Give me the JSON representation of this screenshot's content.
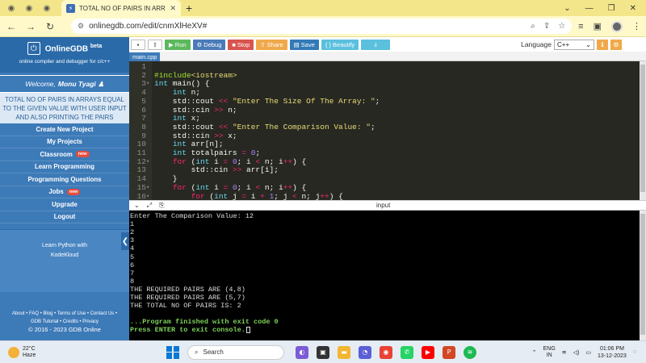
{
  "browser": {
    "tab_title": "TOTAL NO OF PAIRS IN ARRAYS",
    "tab_favicon": "⚡",
    "url": "onlinegdb.com/edit/cnmXlHeXV#"
  },
  "sidebar": {
    "logo_name": "OnlineGDB",
    "logo_beta": "beta",
    "logo_sub": "online compiler and debugger for c/c++",
    "welcome_prefix": "Welcome,",
    "welcome_user": "Monu Tyagi ♟",
    "program_title": "TOTAL NO OF PAIRS IN ARRAYS EQUAL TO THE GIVEN VALUE WITH USER INPUT AND ALSO PRINTING THE PAIRS",
    "items": [
      {
        "label": "Create New Project"
      },
      {
        "label": "My Projects"
      },
      {
        "label": "Classroom",
        "badge": "new"
      },
      {
        "label": "Learn Programming"
      },
      {
        "label": "Programming Questions"
      },
      {
        "label": "Jobs",
        "badge": "new"
      },
      {
        "label": "Upgrade"
      },
      {
        "label": "Logout"
      }
    ],
    "ad_line1": "Learn Python with",
    "ad_line2": "KodeKloud",
    "footer_line1": "About • FAQ • Blog • Terms of Use • Contact Us •",
    "footer_line2": "GDB Tutorial • Credits • Privacy",
    "footer_copy": "© 2016 - 2023 GDB Online"
  },
  "toolbar": {
    "run": "Run",
    "debug": "Debug",
    "stop": "Stop",
    "share": "Share",
    "save": "Save",
    "beautify": "{ } Beautify",
    "language_label": "Language",
    "language_value": "C++"
  },
  "file_tab": "main.cpp",
  "editor": {
    "lines": [
      {
        "n": "1",
        "fold": "",
        "html": ""
      },
      {
        "n": "2",
        "fold": "",
        "html": "<span class=\"pp\">#include</span><span class=\"st\">&lt;iostream&gt;</span>"
      },
      {
        "n": "3",
        "fold": "▾",
        "html": "<span class=\"ty\">int</span> main() {"
      },
      {
        "n": "4",
        "fold": "",
        "html": "    <span class=\"ty\">int</span> n;"
      },
      {
        "n": "5",
        "fold": "",
        "html": "    std::cout <span class=\"op\">&lt;&lt;</span> <span class=\"st\">\"Enter The Size Of The Array: \"</span>;"
      },
      {
        "n": "6",
        "fold": "",
        "html": "    std::cin <span class=\"op\">&gt;&gt;</span> n;"
      },
      {
        "n": "7",
        "fold": "",
        "html": "    <span class=\"ty\">int</span> x;"
      },
      {
        "n": "8",
        "fold": "",
        "html": "    std::cout <span class=\"op\">&lt;&lt;</span> <span class=\"st\">\"Enter The Comparison Value: \"</span>;"
      },
      {
        "n": "9",
        "fold": "",
        "html": "    std::cin <span class=\"op\">&gt;&gt;</span> x;"
      },
      {
        "n": "10",
        "fold": "",
        "html": "    <span class=\"ty\">int</span> arr[n];"
      },
      {
        "n": "11",
        "fold": "",
        "html": "    <span class=\"ty\">int</span> totalpairs <span class=\"op\">=</span> <span class=\"nu\">0</span>;"
      },
      {
        "n": "12",
        "fold": "▾",
        "html": "    <span class=\"kw\">for</span> (<span class=\"ty\">int</span> i <span class=\"op\">=</span> <span class=\"nu\">0</span>; i <span class=\"op\">&lt;</span> n; i<span class=\"op\">++</span>) {"
      },
      {
        "n": "13",
        "fold": "",
        "html": "        std::cin <span class=\"op\">&gt;&gt;</span> arr[i];"
      },
      {
        "n": "14",
        "fold": "",
        "html": "    }"
      },
      {
        "n": "15",
        "fold": "▾",
        "html": "    <span class=\"kw\">for</span> (<span class=\"ty\">int</span> i <span class=\"op\">=</span> <span class=\"nu\">0</span>; i <span class=\"op\">&lt;</span> n; i<span class=\"op\">++</span>) {"
      },
      {
        "n": "16",
        "fold": "▾",
        "html": "        <span class=\"kw\">for</span> (<span class=\"ty\">int</span> j <span class=\"op\">=</span> i <span class=\"op\">+</span> <span class=\"nu\">1</span>; j <span class=\"op\">&lt;</span> n; j<span class=\"op\">++</span>) {"
      }
    ]
  },
  "console": {
    "title": "input",
    "lines": [
      {
        "text": "Enter The Comparison Value: 12",
        "style": ""
      },
      {
        "text": "1",
        "style": ""
      },
      {
        "text": "2",
        "style": ""
      },
      {
        "text": "3",
        "style": ""
      },
      {
        "text": "4",
        "style": ""
      },
      {
        "text": "5",
        "style": ""
      },
      {
        "text": "6",
        "style": ""
      },
      {
        "text": "7",
        "style": ""
      },
      {
        "text": "8",
        "style": ""
      },
      {
        "text": "THE REQUIRED PAIRS ARE (4,8)",
        "style": ""
      },
      {
        "text": "THE REQUIRED PAIRS ARE (5,7)",
        "style": ""
      },
      {
        "text": "THE TOTAL NO OF PAIRS IS: 2",
        "style": ""
      },
      {
        "text": "",
        "style": ""
      },
      {
        "text": "...Program finished with exit code 0",
        "style": "green"
      },
      {
        "text": "Press ENTER to exit console.",
        "style": "green"
      }
    ]
  },
  "taskbar": {
    "temp": "22°C",
    "weather": "Haze",
    "search_placeholder": "Search",
    "lang1": "ENG",
    "lang2": "IN",
    "time": "01:06 PM",
    "date": "13-12-2023"
  },
  "colors": {
    "sidebar_bg": "#3d7ab8",
    "editor_bg": "#272822",
    "browser_accent": "#f3e68a"
  }
}
